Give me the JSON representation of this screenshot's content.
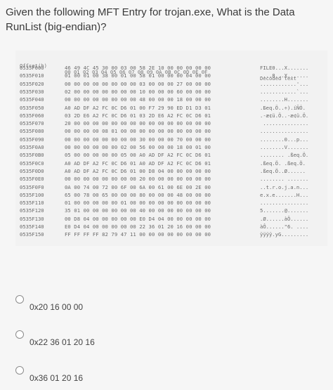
{
  "question": {
    "text": "Given the following MFT Entry for trojan.exe, What is the Data RunList (big-endian)?"
  },
  "hexdump": {
    "header": {
      "offset": "Offset(h)",
      "bytes": "00 01 02 03 04 05 06 07 08 09 0A 0B 0C 0D 0E 0F",
      "decoded": "Decoded text"
    },
    "rows": [
      {
        "addr": "0535F000",
        "bytes": "46 49 4C 45 30 00 03 00 58 2E 10 00 00 00 00 00",
        "dec": "FILE0...X......."
      },
      {
        "addr": "0535F010",
        "bytes": "01 00 01 00 38 00 01 00 58 01 00 00 00 04 00 00",
        "dec": "....8...X......."
      },
      {
        "addr": "0535F020",
        "bytes": "00 00 00 00 00 00 00 00 03 00 00 00 27 00 00 00",
        "dec": "............'..."
      },
      {
        "addr": "0535F030",
        "bytes": "02 00 00 00 00 00 00 00 10 00 00 00 60 00 00 00",
        "dec": "............`..."
      },
      {
        "addr": "0535F040",
        "bytes": "00 00 00 00 00 00 00 00 48 00 00 00 18 00 00 00",
        "dec": "........H......."
      },
      {
        "addr": "0535F050",
        "bytes": "A0 AD DF A2 FC 0C D6 01 00 F7 29 90 ED D1 D3 01",
        "dec": ".Бeq.Ö..÷).íÑÓ."
      },
      {
        "addr": "0535F060",
        "bytes": "03 2D E6 A2 FC 0C D6 01 03 2D E6 A2 FC 0C D6 01",
        "dec": ".-æ¢ü.Ö..-æ¢ü.Ö."
      },
      {
        "addr": "0535F070",
        "bytes": "20 00 00 00 00 00 00 00 00 00 00 00 00 00 00 00",
        "dec": " ..............."
      },
      {
        "addr": "0535F080",
        "bytes": "00 00 00 00 08 01 00 00 00 00 00 00 00 00 00 00",
        "dec": "................"
      },
      {
        "addr": "0535F090",
        "bytes": "00 00 00 00 00 00 00 00 30 00 00 00 70 00 00 00",
        "dec": "........0...p..."
      },
      {
        "addr": "0535F0A0",
        "bytes": "00 00 00 00 00 00 02 00 56 00 00 00 18 00 01 00",
        "dec": "........V......."
      },
      {
        "addr": "0535F0B0",
        "bytes": "05 00 00 00 00 00 05 00 A0 AD DF A2 FC 0C D6 01",
        "dec": "........ .ßeq.Ö."
      },
      {
        "addr": "0535F0C0",
        "bytes": "A0 AD DF A2 FC 0C D6 01 A0 AD DF A2 FC 0C D6 01",
        "dec": ".ßeq.Ö. .ßeq.Ö."
      },
      {
        "addr": "0535F0D0",
        "bytes": "A0 AD DF A2 FC 0C D6 01 00 D8 04 00 00 00 00 00",
        "dec": ".ßeq.Ö..Ø......"
      },
      {
        "addr": "0535F0E0",
        "bytes": "00 00 00 00 00 00 00 00 20 00 00 00 00 00 00 00",
        "dec": "........ ......."
      },
      {
        "addr": "0535F0F0",
        "bytes": "0A 00 74 00 72 00 6F 00 6A 00 61 00 6E 00 2E 00",
        "dec": "..t.r.o.j.a.n..."
      },
      {
        "addr": "0535F100",
        "bytes": "65 00 78 00 65 00 00 00 80 00 00 00 48 00 00 00",
        "dec": "e.x.e.......H..."
      },
      {
        "addr": "0535F110",
        "bytes": "01 00 00 00 00 00 01 00 00 00 00 00 00 00 00 00",
        "dec": "................"
      },
      {
        "addr": "0535F120",
        "bytes": "35 01 00 00 00 00 00 00 40 00 00 00 00 00 00 00",
        "dec": "5.......@......."
      },
      {
        "addr": "0535F130",
        "bytes": "00 D8 04 00 00 00 00 00 E0 D4 04 00 00 00 00 00",
        "dec": ".Ø......àÔ......"
      },
      {
        "addr": "0535F140",
        "bytes": "E0 D4 04 00 00 00 00 00 22 36 01 20 16 00 00 00",
        "dec": "àÔ......\"6. ...."
      },
      {
        "addr": "0535F150",
        "bytes": "FF FF FF FF 82 79 47 11 00 00 00 00 00 00 00 00",
        "dec": "ÿÿÿÿ.yG........."
      }
    ]
  },
  "options": [
    {
      "label": "0x20 16 00 00"
    },
    {
      "label": "0x22 36 01 20 16"
    },
    {
      "label": "0x36 01 20 16"
    }
  ]
}
